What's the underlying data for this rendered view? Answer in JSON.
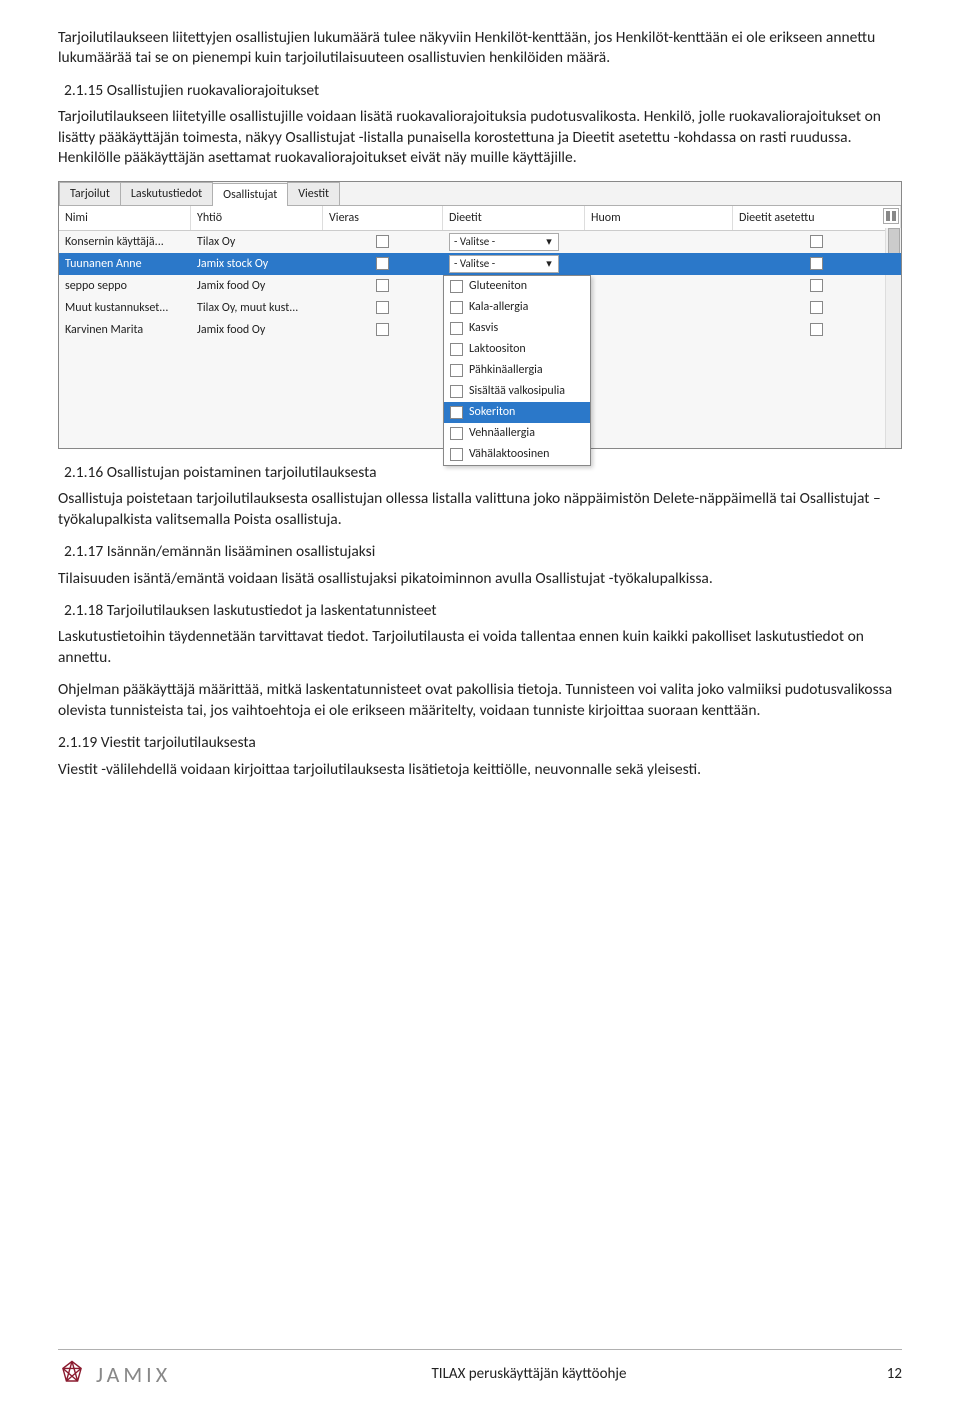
{
  "intro_para": "Tarjoilutilaukseen liitettyjen osallistujien lukumäärä tulee näkyviin Henkilöt-kenttään, jos Henkilöt-kenttään ei ole erikseen annettu lukumäärää tai se on pienempi kuin tarjoilutilaisuuteen osallistuvien henkilöiden määrä.",
  "h215": "2.1.15 Osallistujien ruokavaliorajoitukset",
  "p215a": "Tarjoilutilaukseen liitetyille osallistujille voidaan lisätä ruokavaliorajoituksia pudotusvalikosta. Henkilö, jolle ruokavaliorajoitukset on lisätty pääkäyttäjän toimesta, näkyy Osallistujat -listalla punaisella korostettuna ja Dieetit asetettu -kohdassa on rasti ruudussa. Henkilölle pääkäyttäjän asettamat ruokavaliorajoitukset eivät näy muille käyttäjille.",
  "tabs": {
    "t1": "Tarjoilut",
    "t2": "Laskutustiedot",
    "t3": "Osallistujat",
    "t4": "Viestit"
  },
  "headers": {
    "nimi": "Nimi",
    "yhtio": "Yhtiö",
    "vieras": "Vieras",
    "dieetit": "Dieetit",
    "huom": "Huom",
    "dset": "Dieetit asetettu"
  },
  "rows": [
    {
      "nimi": "Konsernin käyttäjä...",
      "yhtio": "Tilax Oy",
      "dieetit": "- Valitse -"
    },
    {
      "nimi": "Tuunanen Anne",
      "yhtio": "Jamix stock Oy",
      "dieetit": "- Valitse -"
    },
    {
      "nimi": "seppo seppo",
      "yhtio": "Jamix food Oy"
    },
    {
      "nimi": "Muut kustannukset...",
      "yhtio": "Tilax Oy, muut kust..."
    },
    {
      "nimi": "Karvinen Marita",
      "yhtio": "Jamix food Oy"
    }
  ],
  "dropdown": [
    "Gluteeniton",
    "Kala-allergia",
    "Kasvis",
    "Laktoositon",
    "Pähkinäallergia",
    "Sisältää valkosipulia",
    "Sokeriton",
    "Vehnäallergia",
    "Vähälaktoosinen"
  ],
  "h216": "2.1.16 Osallistujan poistaminen tarjoilutilauksesta",
  "p216": "Osallistuja poistetaan tarjoilutilauksesta osallistujan ollessa listalla valittuna joko näppäimistön Delete-näppäimellä tai Osallistujat –työkalupalkista valitsemalla Poista osallistuja.",
  "h217": "2.1.17 Isännän/emännän lisääminen osallistujaksi",
  "p217": "Tilaisuuden isäntä/emäntä voidaan lisätä osallistujaksi pikatoiminnon avulla Osallistujat -työkalupalkissa.",
  "h218": "2.1.18 Tarjoilutilauksen laskutustiedot ja laskentatunnisteet",
  "p218a": "Laskutustietoihin täydennetään tarvittavat tiedot. Tarjoilutilausta ei voida tallentaa ennen kuin kaikki pakolliset laskutustiedot on annettu.",
  "p218b": "Ohjelman pääkäyttäjä määrittää, mitkä laskentatunnisteet ovat pakollisia tietoja. Tunnisteen voi valita joko valmiiksi pudotusvalikossa olevista tunnisteista tai, jos vaihtoehtoja ei ole erikseen määritelty, voidaan tunniste kirjoittaa suoraan kenttään.",
  "h219": "2.1.19 Viestit tarjoilutilauksesta",
  "p219": "Viestit -välilehdellä voidaan kirjoittaa tarjoilutilauksesta lisätietoja keittiölle,  neuvonnalle sekä yleisesti.",
  "footer": {
    "brand": "JAMIX",
    "title": "TILAX peruskäyttäjän käyttöohje",
    "page": "12"
  }
}
